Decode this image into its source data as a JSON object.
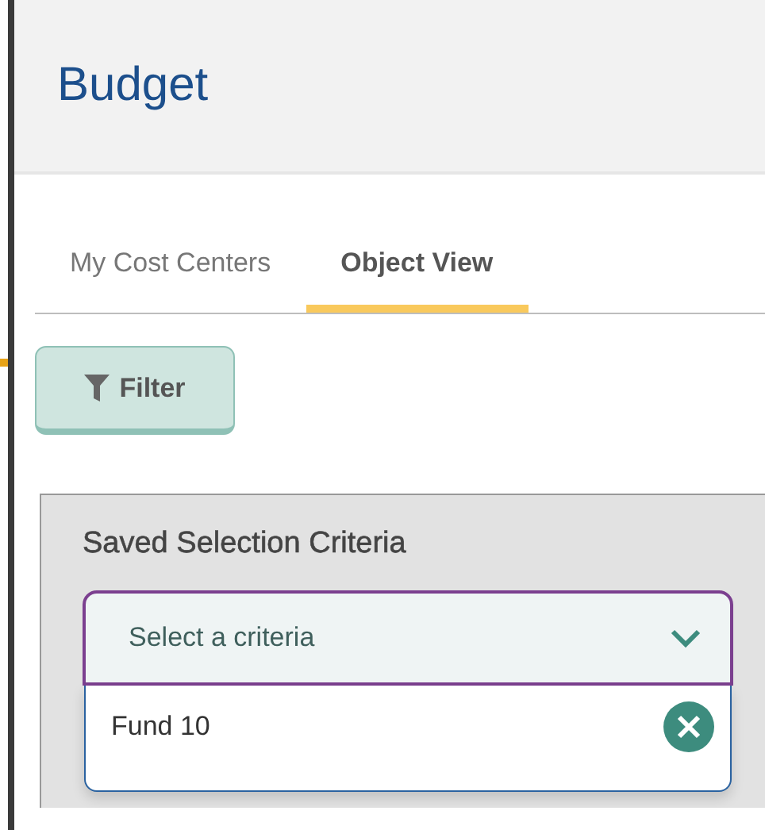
{
  "page": {
    "title": "Budget"
  },
  "tabs": [
    {
      "label": "My Cost Centers",
      "selected": false
    },
    {
      "label": "Object View",
      "selected": true
    }
  ],
  "filter_button": {
    "label": "Filter"
  },
  "saved_criteria": {
    "title": "Saved Selection Criteria",
    "dropdown": {
      "placeholder": "Select a criteria",
      "expanded": true,
      "options": [
        {
          "label": "Fund 10"
        }
      ]
    }
  }
}
